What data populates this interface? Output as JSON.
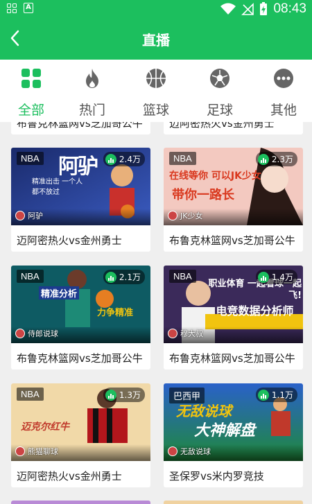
{
  "status_bar": {
    "time": "08:43",
    "notification_a": "A"
  },
  "app_bar": {
    "title": "直播"
  },
  "categories": [
    {
      "label": "全部",
      "icon": "grid-icon",
      "active": true
    },
    {
      "label": "热门",
      "icon": "flame-icon",
      "active": false
    },
    {
      "label": "篮球",
      "icon": "basketball-icon",
      "active": false
    },
    {
      "label": "足球",
      "icon": "soccer-ball-icon",
      "active": false
    },
    {
      "label": "其他",
      "icon": "more-icon",
      "active": false
    }
  ],
  "partial_row": {
    "left_title": "布鲁克林篮网vs芝加哥公牛",
    "right_title": "迈阿密热火vs金州勇士"
  },
  "cards": [
    {
      "badge": "NBA",
      "viewers": "2.4万",
      "anchor": "阿驴",
      "title": "迈阿密热火vs金州勇士",
      "overlay": "阿驴",
      "overlay_small": "精准出击 一个人都不放过"
    },
    {
      "badge": "NBA",
      "viewers": "2.3万",
      "anchor": "JK少女",
      "title": "布鲁克林篮网vs芝加哥公牛",
      "overlay": "带你一路长",
      "overlay_small": "在线等你 可以JK少女"
    },
    {
      "badge": "NBA",
      "viewers": "2.1万",
      "anchor": "侍郎说球",
      "title": "布鲁克林篮网vs芝加哥公牛",
      "overlay": "精准分析",
      "overlay_small": "力争精准"
    },
    {
      "badge": "NBA",
      "viewers": "1.4万",
      "anchor": "穆大叔",
      "title": "布鲁克林篮网vs芝加哥公牛",
      "overlay": "电竞数据分析师",
      "overlay_small": "职业体育 一起看球一起飞!"
    },
    {
      "badge": "NBA",
      "viewers": "1.3万",
      "anchor": "熊猫聊球",
      "title": "迈阿密热火vs金州勇士",
      "overlay": "迈克尔红牛",
      "overlay_small": ""
    },
    {
      "badge": "巴西甲",
      "viewers": "1.1万",
      "anchor": "无敌说球",
      "title": "圣保罗vs米内罗竞技",
      "overlay": "无敌说球",
      "overlay_small": "大神解盘"
    }
  ],
  "colors": {
    "brand": "#1cbf5e",
    "text": "#222222",
    "muted": "#555555"
  }
}
